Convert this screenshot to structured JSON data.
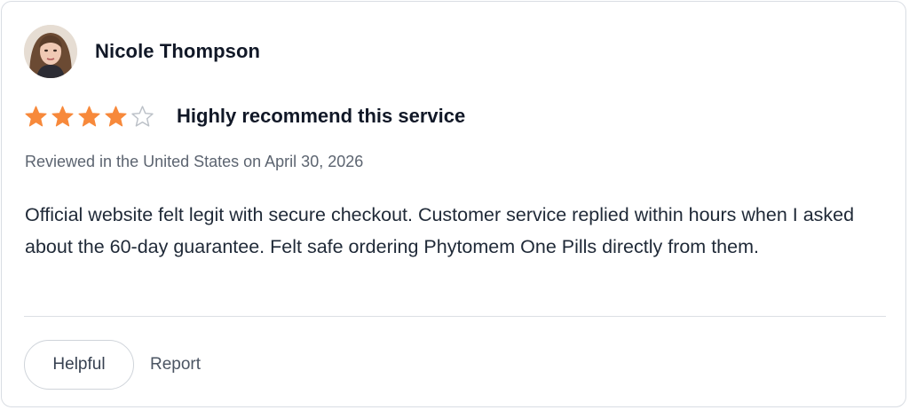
{
  "review": {
    "reviewer_name": "Nicole Thompson",
    "rating": 4,
    "rating_max": 5,
    "title": "Highly recommend this service",
    "meta": "Reviewed in the United States on April 30, 2026",
    "body": "Official website felt legit with secure checkout. Customer service replied within hours when I asked about the 60-day guarantee. Felt safe ordering Phytomem One Pills directly from them."
  },
  "actions": {
    "helpful_label": "Helpful",
    "report_label": "Report"
  },
  "colors": {
    "star_filled": "#f7893b",
    "star_empty": "#bcc1c8"
  },
  "icons": {
    "star_filled": "star-filled-icon",
    "star_empty": "star-outline-icon"
  }
}
